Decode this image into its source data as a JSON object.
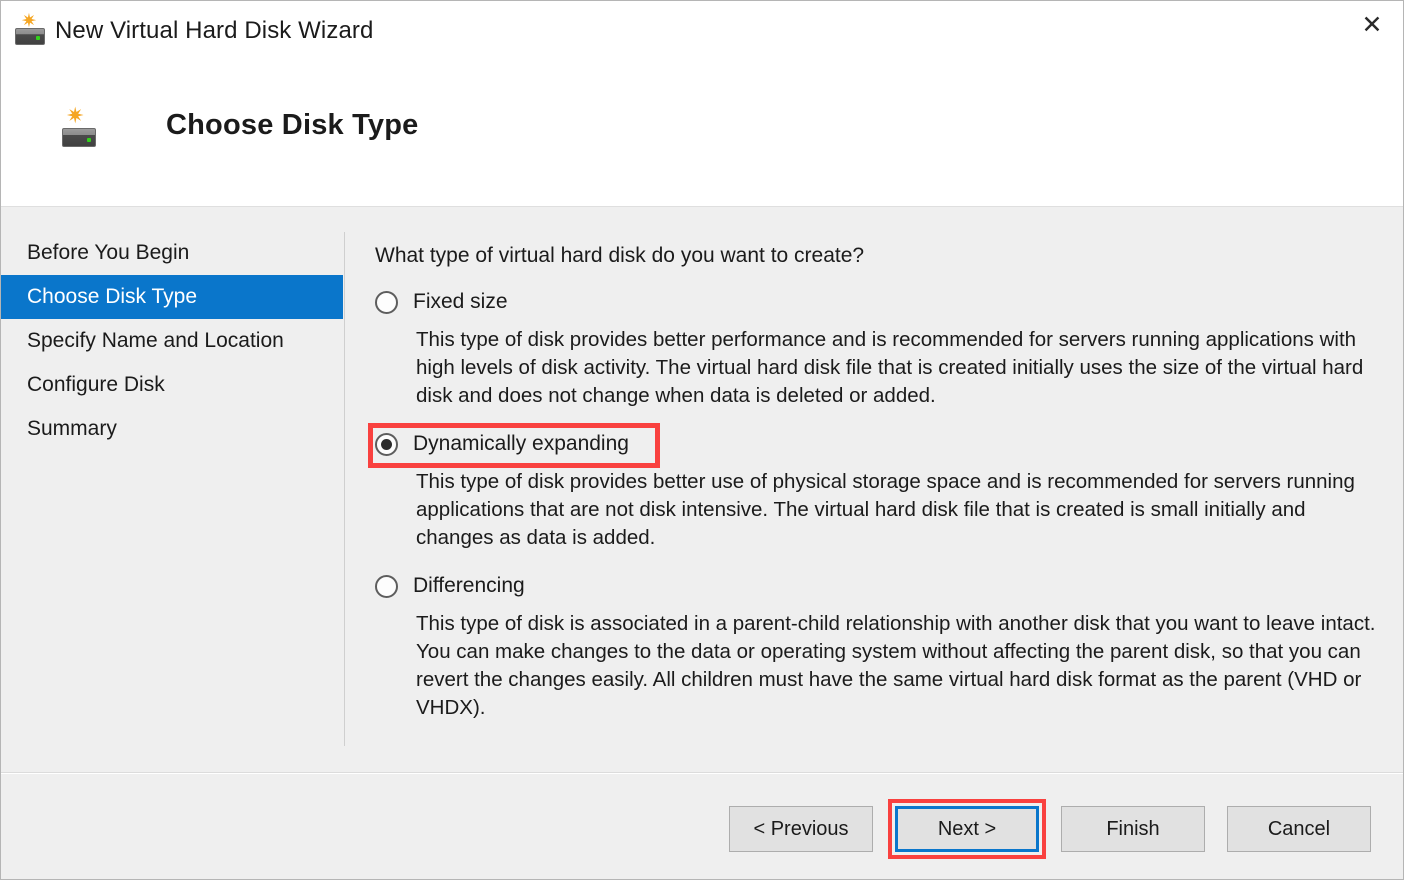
{
  "window": {
    "title": "New Virtual Hard Disk Wizard",
    "title_icon": "new-virtual-hard-disk-icon",
    "close_label": "✕"
  },
  "header": {
    "page_title": "Choose Disk Type",
    "icon": "virtual-hard-disk-icon"
  },
  "sidebar": {
    "items": [
      {
        "label": "Before You Begin",
        "selected": false
      },
      {
        "label": "Choose Disk Type",
        "selected": true
      },
      {
        "label": "Specify Name and Location",
        "selected": false
      },
      {
        "label": "Configure Disk",
        "selected": false
      },
      {
        "label": "Summary",
        "selected": false
      }
    ]
  },
  "main": {
    "question": "What type of virtual hard disk do you want to create?",
    "options": [
      {
        "label": "Fixed size",
        "selected": false,
        "description": "This type of disk provides better performance and is recommended for servers running applications with high levels of disk activity. The virtual hard disk file that is created initially uses the size of the virtual hard disk and does not change when data is deleted or added."
      },
      {
        "label": "Dynamically expanding",
        "selected": true,
        "description": "This type of disk provides better use of physical storage space and is recommended for servers running applications that are not disk intensive. The virtual hard disk file that is created is small initially and changes as data is added."
      },
      {
        "label": "Differencing",
        "selected": false,
        "description": "This type of disk is associated in a parent-child relationship with another disk that you want to leave intact. You can make changes to the data or operating system without affecting the parent disk, so that you can revert the changes easily. All children must have the same virtual hard disk format as the parent (VHD or VHDX)."
      }
    ]
  },
  "footer": {
    "buttons": [
      {
        "label": "< Previous",
        "focused": false,
        "highlighted": false
      },
      {
        "label": "Next >",
        "focused": true,
        "highlighted": true
      },
      {
        "label": "Finish",
        "focused": false,
        "highlighted": false
      },
      {
        "label": "Cancel",
        "focused": false,
        "highlighted": false
      }
    ]
  },
  "colors": {
    "accent_blue": "#0a76cb",
    "annotation_red": "#f9413f",
    "body_background": "#efefef",
    "button_face": "#e1e1e1"
  }
}
